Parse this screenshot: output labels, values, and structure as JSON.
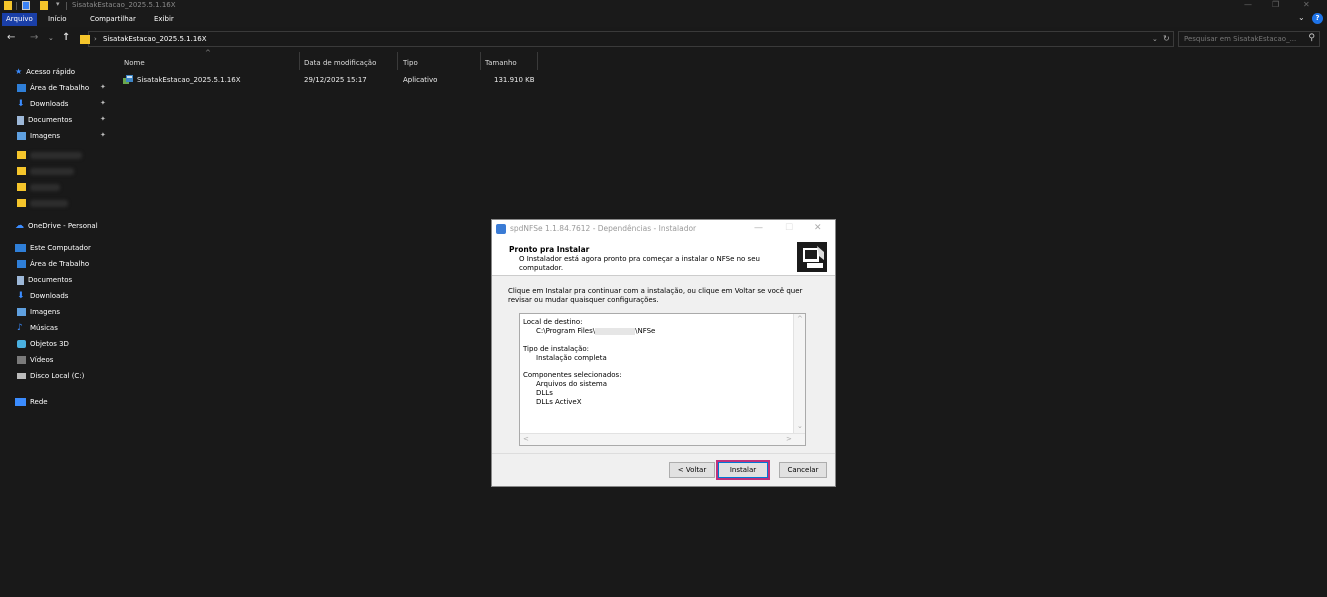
{
  "window": {
    "title": "SisatakEstacao_2025.5.1.16X",
    "controls": [
      "—",
      "❐",
      "✕"
    ]
  },
  "ribbon": {
    "tabs": [
      "Arquivo",
      "Início",
      "Compartilhar",
      "Exibir"
    ]
  },
  "address": {
    "path": "SisatakEstacao_2025.5.1.16X",
    "search_placeholder": "Pesquisar em SisatakEstacao_..."
  },
  "sidebar": {
    "quick_access": "Acesso rápido",
    "quick_items": [
      {
        "label": "Área de Trabalho",
        "icon": "desktop-icon",
        "pinned": true
      },
      {
        "label": "Downloads",
        "icon": "download-icon",
        "pinned": true
      },
      {
        "label": "Documentos",
        "icon": "document-icon",
        "pinned": true
      },
      {
        "label": "Imagens",
        "icon": "image-icon",
        "pinned": true
      }
    ],
    "onedrive": "OneDrive - Personal",
    "this_pc": "Este Computador",
    "pc_items": [
      "Área de Trabalho",
      "Documentos",
      "Downloads",
      "Imagens",
      "Músicas",
      "Objetos 3D",
      "Vídeos",
      "Disco Local (C:)"
    ],
    "network": "Rede"
  },
  "columns": {
    "name": "Nome",
    "modified": "Data de modificação",
    "type": "Tipo",
    "size": "Tamanho"
  },
  "files": [
    {
      "name": "SisatakEstacao_2025.5.1.16X",
      "modified": "29/12/2025 15:17",
      "type": "Aplicativo",
      "size": "131.910 KB"
    }
  ],
  "dialog": {
    "title": "spdNFSe 1.1.84.7612 - Dependências - Instalador",
    "heading": "Pronto pra Instalar",
    "subheading": "O Instalador está agora pronto pra começar a instalar o NFSe no seu computador.",
    "instructions": "Clique em Instalar pra continuar com a instalação, ou clique em Voltar se você quer revisar ou mudar quaisquer configurações.",
    "memo": {
      "dest_label": "Local de destino:",
      "dest_prefix": "C:\\Program Files\\",
      "dest_suffix": "\\NFSe",
      "type_label": "Tipo de instalação:",
      "type_value": "Instalação completa",
      "components_label": "Componentes selecionados:",
      "components": [
        "Arquivos do sistema",
        "DLLs",
        "DLLs ActiveX"
      ]
    },
    "buttons": {
      "back": "< Voltar",
      "install": "Instalar",
      "cancel": "Cancelar"
    }
  },
  "colors": {
    "accent_tab": "#1a3fa8",
    "folder": "#f5c52b",
    "highlight": "#c0317c"
  }
}
